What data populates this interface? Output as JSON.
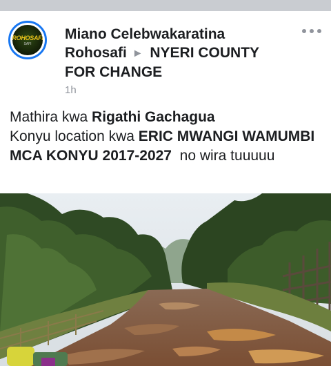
{
  "post": {
    "author": "Miano Celebwakaratina Rohosafi",
    "group": "NYERI COUNTY FOR CHANGE",
    "time": "1h",
    "avatar_label": "ROHOSAFI",
    "avatar_sub": "SAFI",
    "text_line1_prefix": "Mathira kwa ",
    "text_line1_bold": "Rigathi Gachagua",
    "text_line2_prefix": "Konyu location kwa ",
    "text_line2_bold": "ERIC MWANGI WAMUMBI MCA KONYU 2017-2027",
    "text_line2_suffix": "  no wira tuuuuu"
  },
  "icons": {
    "arrow": "caret-right-icon",
    "more": "more-options-icon"
  },
  "colors": {
    "accent": "#1877f2",
    "muted": "#90949c",
    "text": "#1c1e21"
  }
}
